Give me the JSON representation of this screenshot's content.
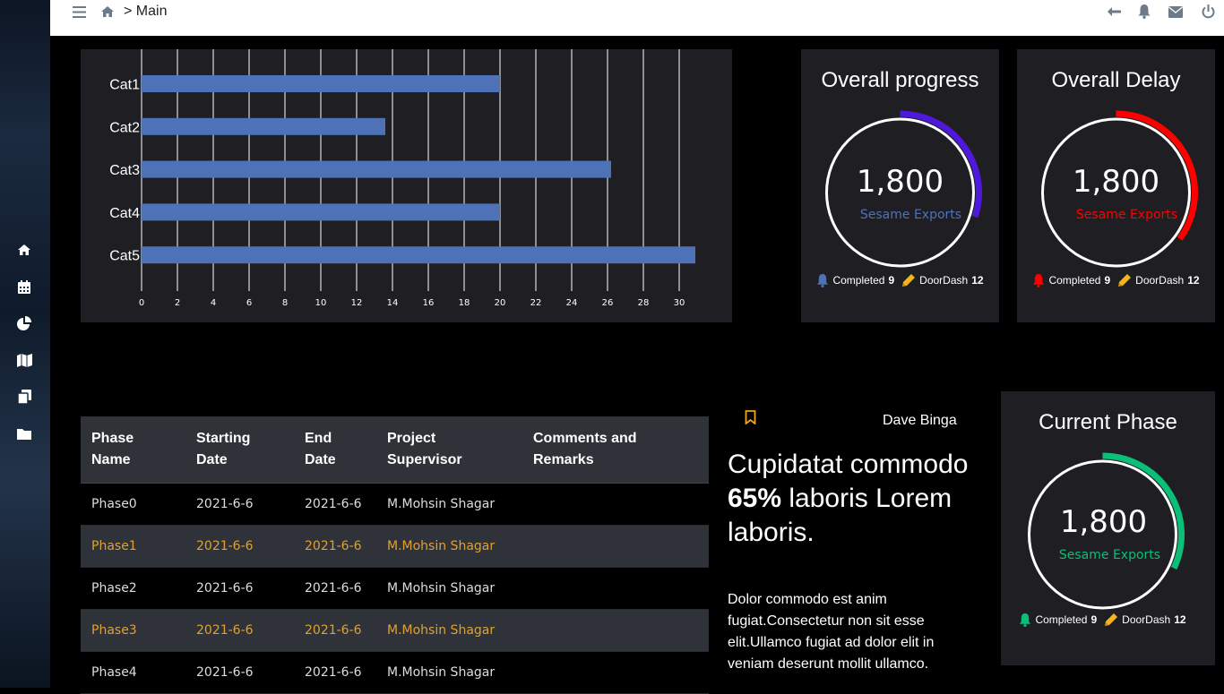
{
  "topbar": {
    "breadcrumb": "> Main",
    "icons": [
      "menu-icon",
      "home-icon",
      "back-arrow-icon",
      "bell-icon",
      "mail-icon",
      "power-icon"
    ]
  },
  "sidebar": {
    "items": [
      "home-icon",
      "calendar-icon",
      "pie-chart-icon",
      "map-icon",
      "copy-icon",
      "folder-icon"
    ]
  },
  "chart_data": {
    "type": "bar",
    "orientation": "horizontal",
    "categories": [
      "Cat1",
      "Cat2",
      "Cat3",
      "Cat4",
      "Cat5"
    ],
    "values": [
      20,
      13.6,
      26.2,
      20,
      30.9
    ],
    "xticks": [
      "0",
      "2",
      "4",
      "6",
      "8",
      "10",
      "12",
      "14",
      "16",
      "18",
      "20",
      "22",
      "24",
      "26",
      "28",
      "30"
    ],
    "xlim": [
      0,
      32
    ],
    "grid": true,
    "bar_color": "#4e72b8"
  },
  "kpis": {
    "progress": {
      "title": "Overall progress",
      "value": "1,800",
      "sub": "Sesame Exports",
      "color": "#4f18db",
      "sub_color": "#4e72b8",
      "bell_color": "#4e72b8",
      "fraction": 0.3,
      "completed_label": "Completed",
      "completed_value": "9",
      "door_label": "DoorDash",
      "door_value": "12"
    },
    "delay": {
      "title": "Overall Delay",
      "value": "1,800",
      "sub": "Sesame Exports",
      "color": "#ff0000",
      "sub_color": "#ff0000",
      "bell_color": "#ff0000",
      "fraction": 0.35,
      "completed_label": "Completed",
      "completed_value": "9",
      "door_label": "DoorDash",
      "door_value": "12"
    },
    "phase": {
      "title": "Current Phase",
      "value": "1,800",
      "sub": "Sesame Exports",
      "color": "#0bbf79",
      "sub_color": "#0bbf79",
      "bell_color": "#0bbf79",
      "fraction": 0.32,
      "completed_label": "Completed",
      "completed_value": "9",
      "door_label": "DoorDash",
      "door_value": "12"
    }
  },
  "table": {
    "headers": [
      "Phase Name",
      "Starting Date",
      "End Date",
      "Project Supervisor",
      "Comments and Remarks"
    ],
    "rows": [
      [
        "Phase0",
        "2021-6-6",
        "2021-6-6",
        "M.Mohsin Shagar",
        ""
      ],
      [
        "Phase1",
        "2021-6-6",
        "2021-6-6",
        "M.Mohsin Shagar",
        ""
      ],
      [
        "Phase2",
        "2021-6-6",
        "2021-6-6",
        "M.Mohsin Shagar",
        ""
      ],
      [
        "Phase3",
        "2021-6-6",
        "2021-6-6",
        "M.Mohsin Shagar",
        ""
      ],
      [
        "Phase4",
        "2021-6-6",
        "2021-6-6",
        "M.Mohsin Shagar",
        ""
      ]
    ]
  },
  "article": {
    "author": "Dave Binga",
    "headline_pre": "Cupidatat commodo ",
    "headline_bold": "65%",
    "headline_post": " laboris Lorem laboris.",
    "body": "Dolor commodo est anim fugiat.Consectetur non sit esse elit.Ullamco fugiat ad dolor elit in veniam deserunt mollit ullamco."
  }
}
